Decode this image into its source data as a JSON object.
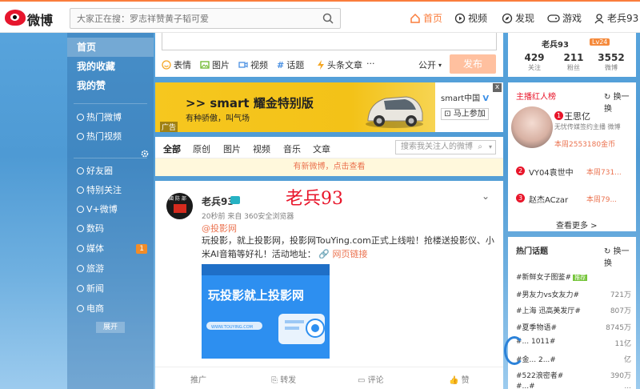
{
  "header": {
    "logo_text": "微博",
    "search_placeholder": "大家正在搜：罗志祥赞黄子韬可爱",
    "nav": {
      "home": "首页",
      "video": "视频",
      "discover": "发现",
      "game": "游戏",
      "user": "老兵93"
    },
    "accent_color": "#fa7d3c"
  },
  "sidebar": {
    "items": [
      {
        "label": "首页"
      },
      {
        "label": "我的收藏"
      },
      {
        "label": "我的赞"
      },
      {
        "label": "热门微博"
      },
      {
        "label": "热门视频"
      },
      {
        "label": "好友圈"
      },
      {
        "label": "特别关注"
      },
      {
        "label": "V+微博"
      },
      {
        "label": "数码"
      },
      {
        "label": "媒体",
        "badge": "1"
      },
      {
        "label": "旅游"
      },
      {
        "label": "新闻"
      },
      {
        "label": "电商"
      }
    ],
    "expand": "展开"
  },
  "composer": {
    "tools": [
      "表情",
      "图片",
      "视频",
      "话题",
      "头条文章",
      "···"
    ],
    "visibility": "公开",
    "publish": "发布"
  },
  "ad": {
    "headline": ">> smart 耀金特别版",
    "subline": "有种骄傲，叫气场",
    "tag": "广告",
    "brand": "smart中国",
    "follow": "马上参加",
    "close": "x"
  },
  "feed_tabs": {
    "tabs": [
      "全部",
      "原创",
      "图片",
      "视频",
      "音乐",
      "文章"
    ],
    "search_placeholder": "搜索我关注人的微博",
    "new_posts": "有新微博，点击查看"
  },
  "post": {
    "author": "老兵93",
    "watermark": "老兵93",
    "meta": "20秒前 来自 360安全浏览器",
    "mention": "@投影网",
    "body": "玩投影，就上投影网，投影网TouYing.com正式上线啦！抢楼送投影仪、小米AI音箱等好礼！活动地址：",
    "link": "网页链接",
    "image_title": "玩投影就上投影网",
    "image_url_text": "WWW.TOUYING.COM",
    "actions": [
      "推广",
      "转发",
      "评论",
      "赞"
    ]
  },
  "profile": {
    "name": "老兵93",
    "level": "Lv24",
    "stats": [
      {
        "n": "429",
        "l": "关注"
      },
      {
        "n": "211",
        "l": "粉丝"
      },
      {
        "n": "3552",
        "l": "微博"
      }
    ]
  },
  "hosts": {
    "title": "主播红人榜",
    "swap": "换一换",
    "top": {
      "name": "王思亿",
      "desc": "无忧传媒签约主播 微博",
      "week": "本周2553180金币"
    },
    "others": [
      {
        "rank": "2",
        "name": "VY04袁世中",
        "week": "本周731..."
      },
      {
        "rank": "3",
        "name": "赵杰ACzar",
        "week": "本周79..."
      }
    ],
    "more": "查看更多 >"
  },
  "topics": {
    "title": "热门话题",
    "swap": "换一换",
    "items": [
      {
        "name": "#新鲜女子图鉴#",
        "badge": "推荐",
        "count": ""
      },
      {
        "name": "#男友力vs女友力#",
        "count": "721万"
      },
      {
        "name": "#上海 迅高美发厅#",
        "count": "807万"
      },
      {
        "name": "#夏季物语#",
        "count": "8745万"
      },
      {
        "name": "#... 1011#",
        "count": "11亿"
      },
      {
        "name": "#金... 2...#",
        "count": "亿"
      },
      {
        "name": "#522浪密者#",
        "count": "390万"
      },
      {
        "name": "#...#",
        "count": "..."
      }
    ]
  }
}
